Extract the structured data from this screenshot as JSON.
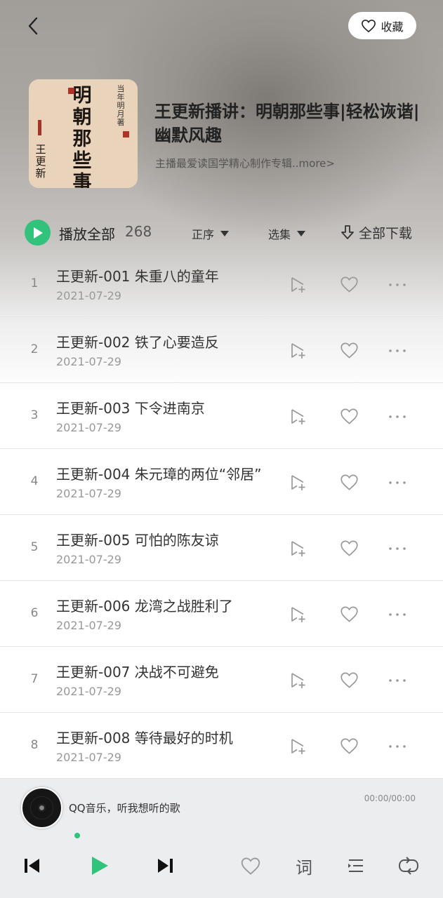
{
  "header": {
    "fav_label": "收藏"
  },
  "album": {
    "cover_title": "明朝那些事儿",
    "cover_side": "当年明月 著",
    "cover_author": "王更新",
    "title": "王更新播讲：明朝那些事|轻松诙谐|幽默风趣",
    "description": "主播最爱读国学精心制作专辑..more>"
  },
  "controls": {
    "play_all": "播放全部",
    "count": "268",
    "sort": "正序",
    "select": "选集",
    "download": "全部下载"
  },
  "tracks": [
    {
      "index": "1",
      "title": "王更新-001 朱重八的童年",
      "date": "2021-07-29"
    },
    {
      "index": "2",
      "title": "王更新-002 铁了心要造反",
      "date": "2021-07-29"
    },
    {
      "index": "3",
      "title": "王更新-003 下令进南京",
      "date": "2021-07-29"
    },
    {
      "index": "4",
      "title": "王更新-004 朱元璋的两位“邻居”",
      "date": "2021-07-29"
    },
    {
      "index": "5",
      "title": "王更新-005 可怕的陈友谅",
      "date": "2021-07-29"
    },
    {
      "index": "6",
      "title": "王更新-006 龙湾之战胜利了",
      "date": "2021-07-29"
    },
    {
      "index": "7",
      "title": "王更新-007 决战不可避免",
      "date": "2021-07-29"
    },
    {
      "index": "8",
      "title": "王更新-008 等待最好的时机",
      "date": "2021-07-29"
    }
  ],
  "player": {
    "song": "QQ音乐，听我想听的歌",
    "time": "00:00/00:00",
    "lyrics_label": "词",
    "progress": 0
  },
  "colors": {
    "accent": "#31c27c"
  },
  "icons": [
    "back-icon",
    "heart-icon",
    "play-icon",
    "sort-down-icon",
    "download-icon",
    "add-to-playlist-icon",
    "more-icon",
    "prev-icon",
    "next-icon",
    "playlist-icon",
    "loop-icon"
  ]
}
